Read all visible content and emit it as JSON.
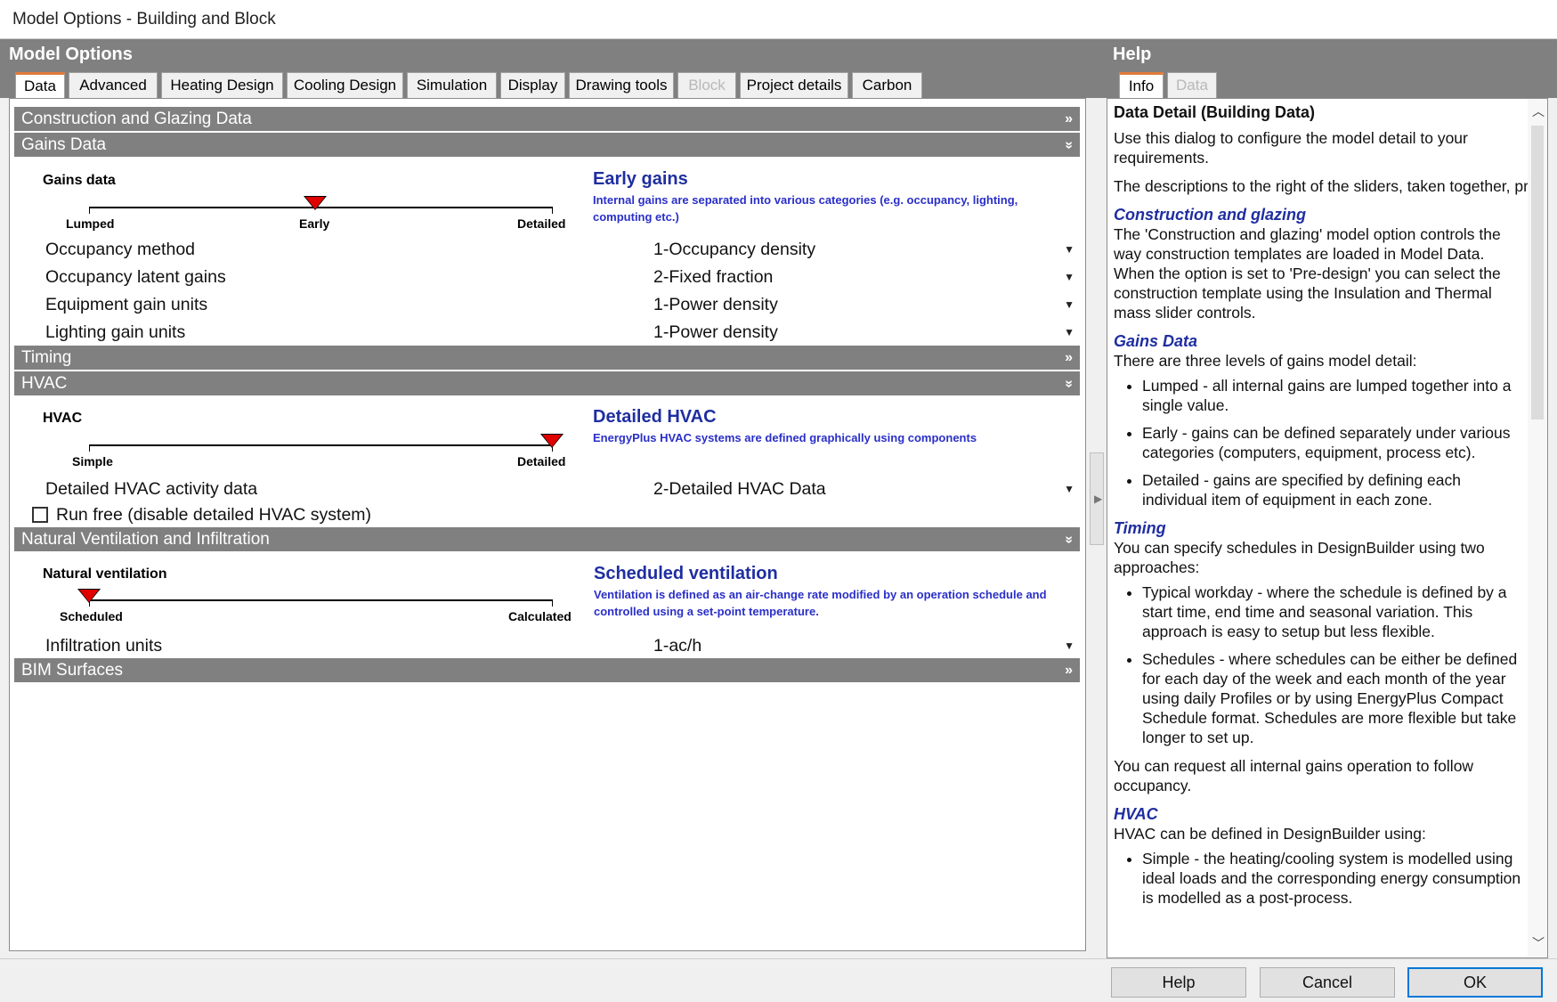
{
  "window": {
    "title": "Model Options - Building and Block"
  },
  "left_header": "Model Options",
  "help_header": "Help",
  "tabs": [
    {
      "label": "Data",
      "active": true,
      "enabled": true
    },
    {
      "label": "Advanced",
      "active": false,
      "enabled": true
    },
    {
      "label": "Heating Design",
      "active": false,
      "enabled": true
    },
    {
      "label": "Cooling Design",
      "active": false,
      "enabled": true
    },
    {
      "label": "Simulation",
      "active": false,
      "enabled": true
    },
    {
      "label": "Display",
      "active": false,
      "enabled": true
    },
    {
      "label": "Drawing tools",
      "active": false,
      "enabled": true
    },
    {
      "label": "Block",
      "active": false,
      "enabled": false
    },
    {
      "label": "Project details",
      "active": false,
      "enabled": true
    },
    {
      "label": "Carbon",
      "active": false,
      "enabled": true
    }
  ],
  "help_tabs": [
    {
      "label": "Info",
      "active": true
    },
    {
      "label": "Data",
      "active": false
    }
  ],
  "sections": {
    "construction": {
      "title": "Construction and Glazing Data",
      "chevron": "»"
    },
    "gains": {
      "title": "Gains Data",
      "chevron": "»"
    },
    "timing": {
      "title": "Timing",
      "chevron": "»"
    },
    "hvac": {
      "title": "HVAC",
      "chevron": "»"
    },
    "natvent": {
      "title": "Natural Ventilation and Infiltration",
      "chevron": "»"
    },
    "bim": {
      "title": "BIM Surfaces",
      "chevron": "»"
    }
  },
  "gains": {
    "slider_label": "Gains data",
    "ticks": [
      "Lumped",
      "Early",
      "Detailed"
    ],
    "level": 1,
    "desc_title": "Early gains",
    "desc_text": "Internal gains are separated into various categories (e.g. occupancy, lighting, computing etc.)",
    "rows": [
      {
        "label": "Occupancy method",
        "value": "1-Occupancy density"
      },
      {
        "label": "Occupancy latent gains",
        "value": "2-Fixed fraction"
      },
      {
        "label": "Equipment gain units",
        "value": "1-Power density"
      },
      {
        "label": "Lighting gain units",
        "value": "1-Power density"
      }
    ]
  },
  "hvac": {
    "slider_label": "HVAC",
    "ticks": [
      "Simple",
      "Detailed"
    ],
    "level": 1,
    "desc_title": "Detailed HVAC",
    "desc_text": "EnergyPlus HVAC systems are defined graphically using components",
    "activity_label": "Detailed HVAC activity data",
    "activity_value": "2-Detailed HVAC Data",
    "runfree_label": "Run free (disable detailed HVAC system)",
    "runfree_checked": false
  },
  "natvent": {
    "slider_label": "Natural ventilation",
    "ticks": [
      "Scheduled",
      "Calculated"
    ],
    "level": 0,
    "desc_title": "Scheduled ventilation",
    "desc_text": "Ventilation is defined as an air-change rate modified by an operation schedule and controlled using a set-point temperature.",
    "infiltration_label": "Infiltration units",
    "infiltration_value": "1-ac/h"
  },
  "help": {
    "heading": "Data Detail (Building Data)",
    "intro1": "Use this dialog to configure the model detail to your requirements.",
    "intro2": "The descriptions to the right of the sliders, taken together, provide a summary of the current model detail",
    "construction_title": "Construction and glazing",
    "construction_text": "The 'Construction and glazing' model option controls the way construction templates are loaded in Model Data. When the option is set to 'Pre-design' you can select the construction template using the Insulation and Thermal mass slider controls.",
    "gains_title": "Gains Data",
    "gains_text": "There are three levels of gains model detail:",
    "gains_items": [
      "Lumped - all internal gains are lumped together into a single value.",
      "Early - gains can be defined separately under various categories (computers, equipment, process etc).",
      "Detailed - gains are specified by defining each individual item of equipment in each zone."
    ],
    "timing_title": "Timing",
    "timing_text": "You can specify schedules in DesignBuilder using two approaches:",
    "timing_items": [
      "Typical workday - where the schedule is defined by a start time, end time and seasonal variation. This approach is easy to setup but less flexible.",
      "Schedules - where schedules can be either be defined for each day of the week and each month of the year using daily Profiles or by using EnergyPlus Compact Schedule format. Schedules are more flexible but take longer to set up."
    ],
    "timing_text2": "You can request all internal gains operation to follow occupancy.",
    "hvac_title": "HVAC",
    "hvac_text": "HVAC can be defined in DesignBuilder using:",
    "hvac_items": [
      "Simple - the heating/cooling system is modelled using ideal loads and the corresponding energy consumption is modelled as a post-process."
    ]
  },
  "buttons": {
    "help": "Help",
    "cancel": "Cancel",
    "ok": "OK"
  },
  "colors": {
    "section_bar": "#808080",
    "desc_title": "#1f2ea0",
    "desc_text": "#2a2fc8",
    "slider_thumb": "#e00000",
    "active_tab_accent": "#e07b39",
    "ok_border": "#0078d7"
  }
}
